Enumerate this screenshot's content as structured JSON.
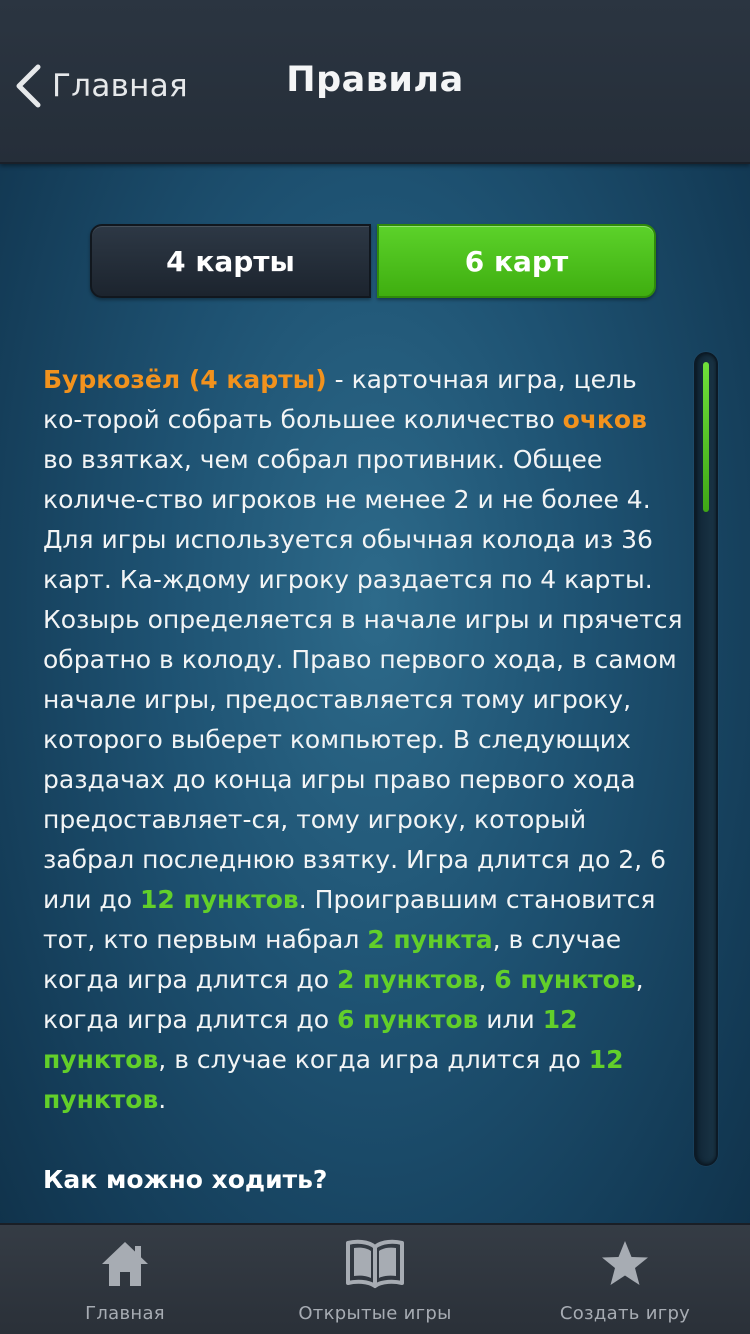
{
  "header": {
    "back_label": "Главная",
    "title": "Правила"
  },
  "segment": {
    "left_label": "4 карты",
    "right_label": "6 карт",
    "selected": "6 карт"
  },
  "rules": {
    "t01": "Буркозёл (4 карты)",
    "t02": " - карточная игра, цель ко-торой собрать большее количество ",
    "t03": "очков",
    "t04": " во взятках, чем собрал противник. Общее количе-ство игроков не менее 2 и не более 4.  Для игры используется обычная колода из 36 карт. Ка-ждому игроку раздается по 4 карты. Козырь определяется в начале игры и прячется обратно в колоду. Право первого хода, в самом начале игры, предоставляется тому игроку, которого выберет компьютер. В следующих раздачах до конца игры право первого хода предоставляет-ся, тому игроку, который забрал последнюю взятку. Игра длится до 2, 6 или до ",
    "t05": "12 пунктов",
    "t06": ". Проигравшим становится тот, кто первым набрал ",
    "t07": "2 пункта",
    "t08": ", в случае когда игра длится до ",
    "t09": "2 пунктов",
    "t10": ", ",
    "t11": "6 пунктов",
    "t12": ", когда игра длится до ",
    "t13": "6 пунктов",
    "t14": " или ",
    "t15": "12 пунктов",
    "t16": ", в случае когда игра длится до ",
    "t17": "12 пунктов",
    "t18": ".",
    "heading": "Как можно ходить?"
  },
  "tabbar": {
    "items": [
      {
        "label": "Главная",
        "icon": "home-icon"
      },
      {
        "label": "Открытые игры",
        "icon": "book-icon"
      },
      {
        "label": "Создать игру",
        "icon": "star-icon"
      }
    ]
  },
  "colors": {
    "accent_green": "#62cf2a",
    "accent_orange": "#f2921d",
    "header_bg": "#2b3541",
    "tabbar_bg": "#353c45"
  }
}
